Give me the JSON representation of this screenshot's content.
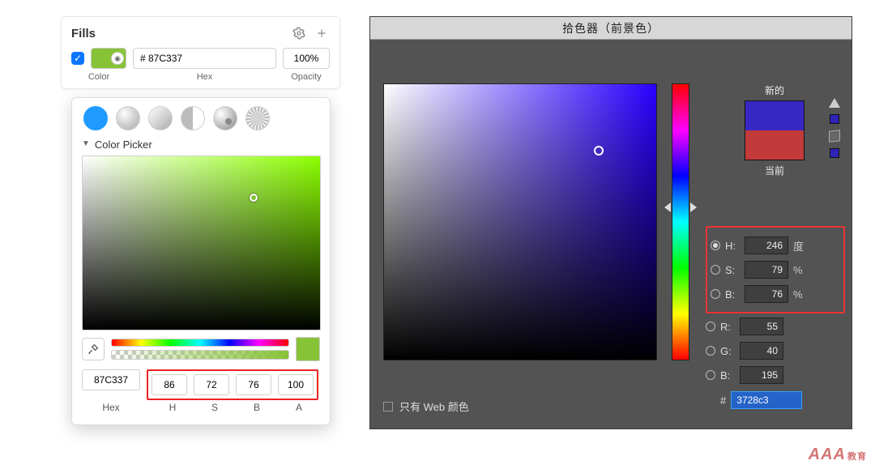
{
  "left": {
    "fills_title": "Fills",
    "checkbox_checked": true,
    "swatch_color": "#87C337",
    "hex_value": "# 87C337",
    "opacity_value": "100%",
    "labels": {
      "color": "Color",
      "hex": "Hex",
      "opacity": "Opacity"
    },
    "picker_title": "Color Picker",
    "hue_for_canvas": "#8CFF00",
    "marker": {
      "x_pct": 72,
      "y_pct": 24
    },
    "preview_color": "#87C337",
    "values": {
      "hex": "87C337",
      "h": "86",
      "s": "72",
      "b": "76",
      "a": "100"
    },
    "value_labels": {
      "hex": "Hex",
      "h": "H",
      "s": "S",
      "b": "B",
      "a": "A"
    }
  },
  "right": {
    "title": "拾色器（前景色）",
    "hue_for_canvas": "#2a00ff",
    "marker": {
      "x_pct": 79,
      "y_pct": 24
    },
    "hue_arrow_top_pct": 43,
    "new_label": "新的",
    "current_label": "当前",
    "new_color": "#3728C3",
    "current_color": "#C33A3A",
    "side_sq_new": "#2b24b7",
    "side_sq_cur": "#2b24b7",
    "fields": {
      "h": {
        "label": "H:",
        "value": "246",
        "unit": "度"
      },
      "s": {
        "label": "S:",
        "value": "79",
        "unit": "%"
      },
      "b": {
        "label": "B:",
        "value": "76",
        "unit": "%"
      },
      "r": {
        "label": "R:",
        "value": "55",
        "unit": ""
      },
      "g": {
        "label": "G:",
        "value": "40",
        "unit": ""
      },
      "bb": {
        "label": "B:",
        "value": "195",
        "unit": ""
      }
    },
    "hex_label": "#",
    "hex_value": "3728c3",
    "web_only": "只有 Web 颜色"
  },
  "watermark": {
    "main": "AAA",
    "sub": "教育"
  }
}
